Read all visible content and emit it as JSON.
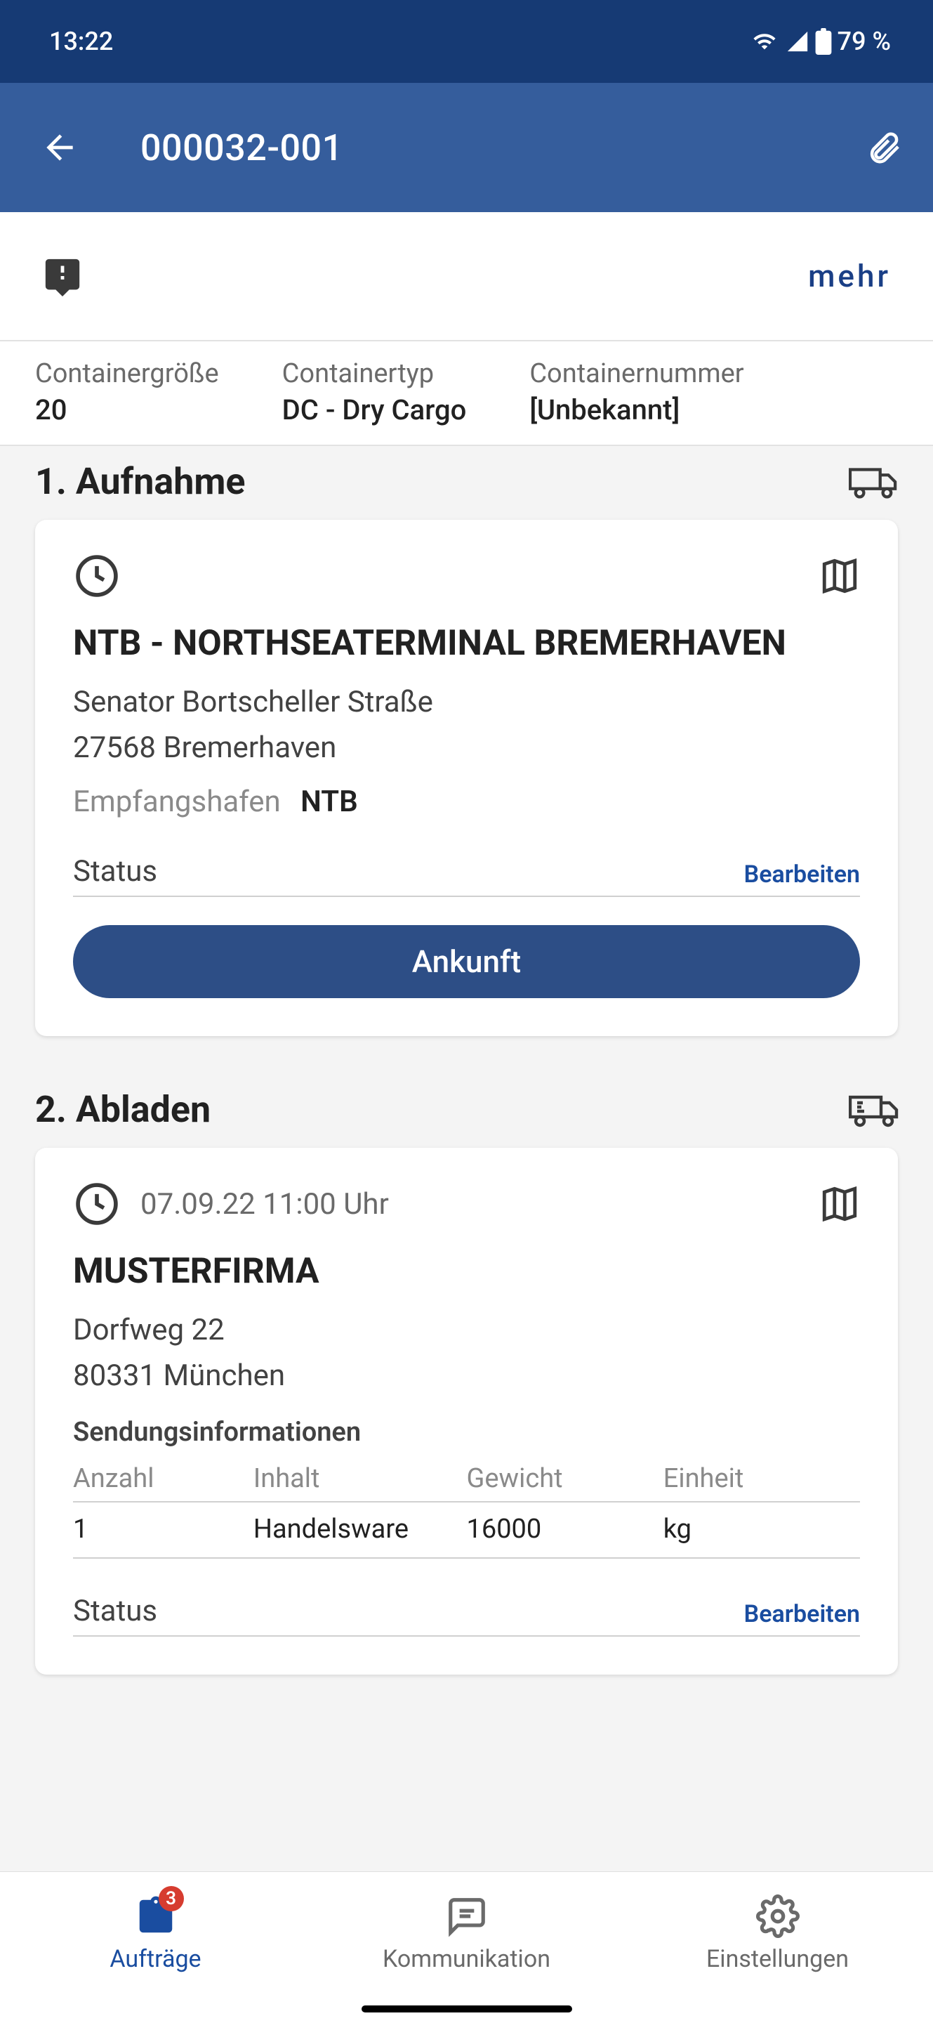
{
  "status_bar": {
    "time": "13:22",
    "battery": "79 %"
  },
  "header": {
    "title": "000032-001",
    "more_label": "mehr"
  },
  "container": {
    "size_label": "Containergröße",
    "size_value": "20",
    "type_label": "Containertyp",
    "type_value": "DC - Dry Cargo",
    "number_label": "Containernummer",
    "number_value": "[Unbekannt]"
  },
  "sections": [
    {
      "title": "1. Aufnahme",
      "time": "",
      "place_name": "NTB - NORTHSEATERMINAL BREMERHAVEN",
      "street": "Senator Bortscheller Straße",
      "city": "27568 Bremerhaven",
      "port_label": "Empfangshafen",
      "port_value": "NTB",
      "status_label": "Status",
      "edit_label": "Bearbeiten",
      "cta_label": "Ankunft"
    },
    {
      "title": "2. Abladen",
      "time": "07.09.22 11:00 Uhr",
      "place_name": "MUSTERFIRMA",
      "street": "Dorfweg 22",
      "city": "80331 München",
      "ship_info_title": "Sendungsinformationen",
      "status_label": "Status",
      "edit_label": "Bearbeiten"
    }
  ],
  "ship_table": {
    "headers": [
      "Anzahl",
      "Inhalt",
      "Gewicht",
      "Einheit"
    ],
    "row": [
      "1",
      "Handelsware",
      "16000",
      "kg"
    ]
  },
  "bottom_nav": {
    "badge": "3",
    "items": [
      "Aufträge",
      "Kommunikation",
      "Einstellungen"
    ]
  }
}
